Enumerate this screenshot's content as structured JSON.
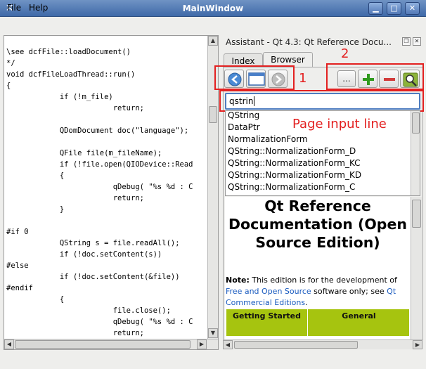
{
  "window": {
    "title": "MainWindow"
  },
  "menu": {
    "file": "File",
    "help": "Help"
  },
  "code_lines": [
    "\\see dcfFile::loadDocument()",
    "*/",
    "void dcfFileLoadThread::run()",
    "{",
    "            if (!m_file)",
    "                        return;",
    "",
    "            QDomDocument doc(\"language\");",
    "",
    "            QFile file(m_fileName);",
    "            if (!file.open(QIODevice::Read",
    "            {",
    "                        qDebug( \"%s %d : C",
    "                        return;",
    "            }",
    "",
    "#if 0",
    "            QString s = file.readAll();",
    "            if (!doc.setContent(s))",
    "#else",
    "            if (!doc.setContent(&file))",
    "#endif",
    "            {",
    "                        file.close();",
    "                        qDebug( \"%s %d : C",
    "                        return;"
  ],
  "assistant": {
    "title": "Assistant - Qt 4.3: Qt Reference Docu...",
    "tabs": {
      "index": "Index",
      "browser": "Browser"
    },
    "search_value": "qstrin",
    "completions": [
      "QString",
      "DataPtr",
      "NormalizationForm",
      "QString::NormalizationForm_D",
      "QString::NormalizationForm_KC",
      "QString::NormalizationForm_KD",
      "QString::NormalizationForm_C"
    ],
    "doc": {
      "heading": "Qt Reference Documentation (Open Source Edition)",
      "note_label": "Note:",
      "note_text_1": " This edition is for the development of ",
      "note_link_1": "Free and Open Source",
      "note_text_2": " software only; see ",
      "note_link_2": "Qt Commercial Editions",
      "note_text_3": ".",
      "table_headers": [
        "Getting Started",
        "General"
      ]
    }
  },
  "annotations": {
    "label_1": "1",
    "label_2": "2",
    "page_input_line": "Page input line"
  },
  "icons": {
    "back": "back-arrow-icon",
    "home": "home-window-icon",
    "forward": "forward-arrow-icon",
    "more": "ellipsis-icon",
    "zoom_in": "plus-icon",
    "zoom_out": "minus-icon",
    "find": "magnifier-icon"
  },
  "colors": {
    "annotation": "#e32020",
    "link": "#1a5bbf",
    "table_header": "#a6c40f",
    "titlebar": "#4f77b4"
  }
}
